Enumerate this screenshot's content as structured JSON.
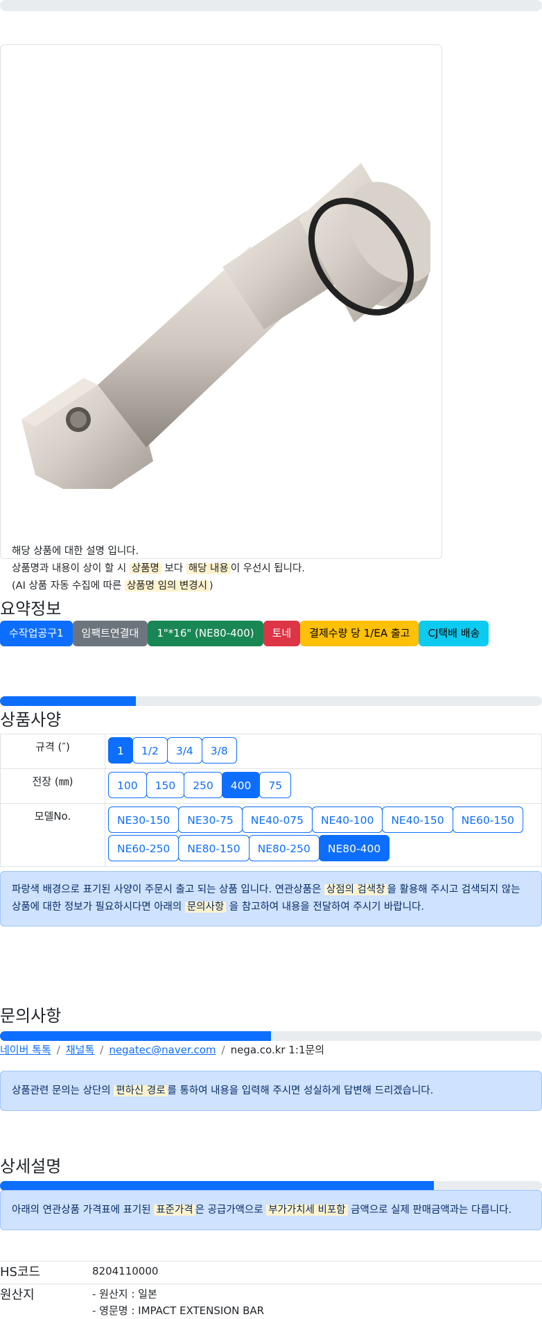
{
  "card": {
    "line1": "해당 상품에 대한 설명 입니다.",
    "line2_a": "상품명과 내용이 상이 할 시 ",
    "line2_hl1": "상품명",
    "line2_b": " 보다 ",
    "line2_hl2": "해당 내용",
    "line2_c": "이 우선시 됩니다.",
    "line3_a": "(AI 상품 자동 수집에 따른 ",
    "line3_hl": "상품명 임의 변경시",
    "line3_b": ")"
  },
  "summary": {
    "title": "요약정보",
    "badges": [
      {
        "label": "수작업공구1",
        "color": "#0d6efd"
      },
      {
        "label": "임팩트연결대",
        "color": "#6c757d"
      },
      {
        "label": "1\"*16\" (NE80-400)",
        "color": "#198754"
      },
      {
        "label": "토네",
        "color": "#dc3545"
      },
      {
        "label": "결제수량 당 1/EA 출고",
        "color": "#ffc107"
      },
      {
        "label": "CJ택배 배송",
        "color": "#0dcaf0"
      }
    ]
  },
  "specs": {
    "title": "상품사양",
    "progress": 0.25,
    "rows": [
      {
        "label": "규격 (″)",
        "options": [
          "1",
          "1/2",
          "3/4",
          "3/8"
        ],
        "selected": "1"
      },
      {
        "label": "전장 (㎜)",
        "options": [
          "100",
          "150",
          "250",
          "400",
          "75"
        ],
        "selected": "400"
      },
      {
        "label": "모델No.",
        "options": [
          "NE30-150",
          "NE30-75",
          "NE40-075",
          "NE40-100",
          "NE40-150",
          "NE60-150",
          "NE60-250",
          "NE80-150",
          "NE80-250",
          "NE80-400"
        ],
        "selected": "NE80-400"
      }
    ],
    "notice_a": "파랑색 배경으로 표기된 사양이 주문시 출고 되는 상품 입니다. 연관상품은 ",
    "notice_hl1": "상점의 검색창",
    "notice_b": "을 활용해 주시고 검색되지 않는 상품에 대한 정보가 필요하시다면 아래의 ",
    "notice_hl2": "문의사항",
    "notice_c": " 을 참고하여 내용을 전달하여 주시기 바랍니다."
  },
  "inquiry": {
    "title": "문의사항",
    "progress": 0.5,
    "links": [
      "네이버 톡톡",
      "채널톡",
      "negatec@naver.com"
    ],
    "last": "nega.co.kr 1:1문의",
    "notice_a": "상품관련 문의는 상단의 ",
    "notice_hl": "편하신 경로",
    "notice_b": "를 통하여 내용을 입력해 주시면 성실하게 답변해 드리겠습니다."
  },
  "detail": {
    "title": "상세설명",
    "progress": 0.8,
    "notice_a": "아래의 연관상품 가격표에 표기된 ",
    "notice_hl1": "표준가격",
    "notice_b": "은 공급가액으로 ",
    "notice_hl2": "부가가치세 비포함",
    "notice_c": " 금액으로 실제 판매금액과는 다릅니다.",
    "hs_label": "HS코드",
    "hs_value": "8204110000",
    "origin_label": "원산지",
    "origin_line1": "- 원산지 : 일본",
    "origin_line2": "- 영문명 : IMPACT EXTENSION BAR"
  }
}
